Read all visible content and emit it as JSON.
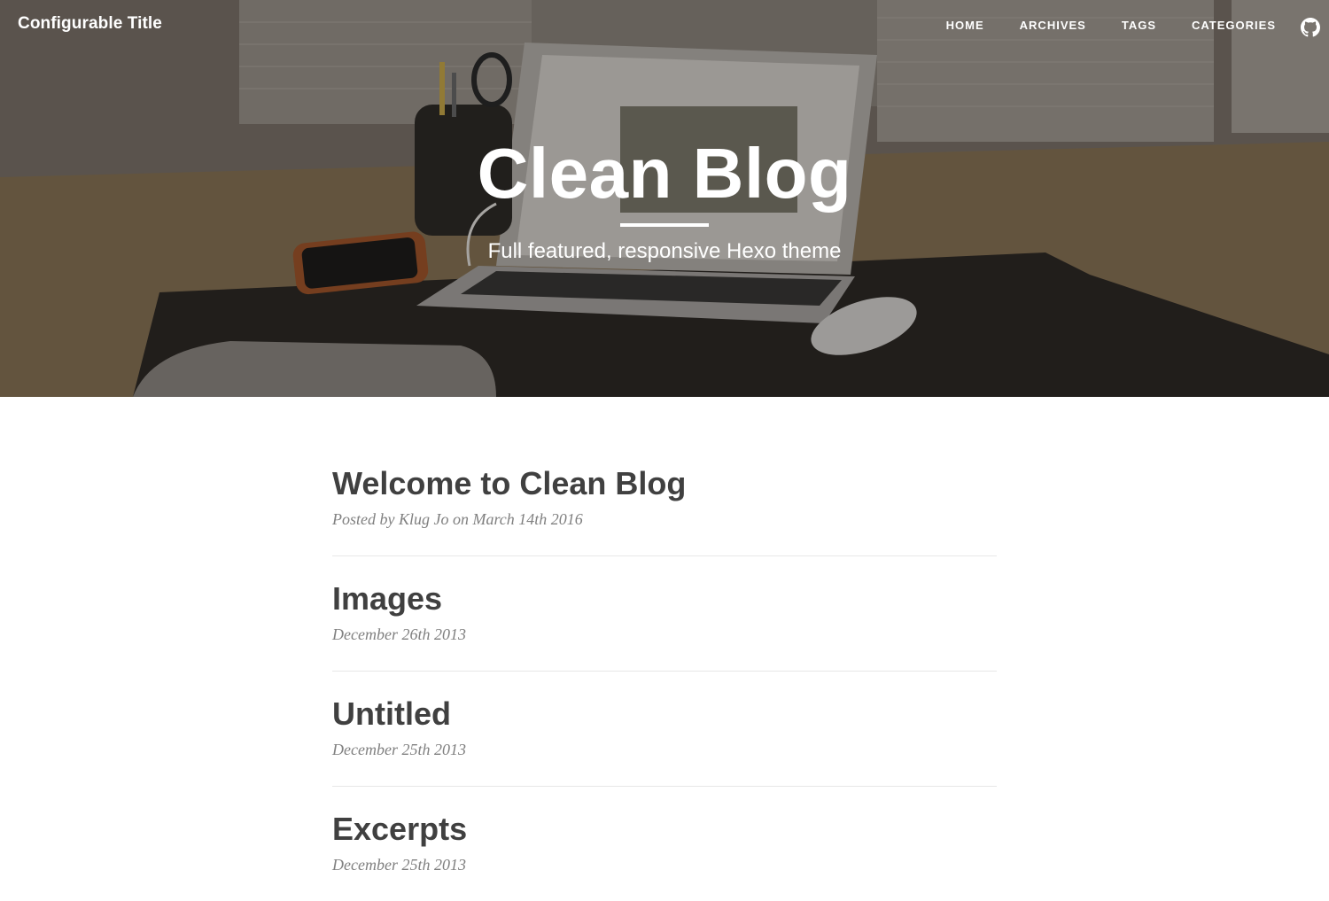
{
  "navbar": {
    "brand": "Configurable Title",
    "links": [
      "HOME",
      "ARCHIVES",
      "TAGS",
      "CATEGORIES"
    ],
    "github_icon": "github-icon"
  },
  "hero": {
    "title": "Clean Blog",
    "subtitle": "Full featured, responsive Hexo theme",
    "background": "desk-with-laptop-photo"
  },
  "posts": [
    {
      "title": "Welcome to Clean Blog",
      "meta": "Posted by Klug Jo on March 14th 2016"
    },
    {
      "title": "Images",
      "meta": "December 26th 2013"
    },
    {
      "title": "Untitled",
      "meta": "December 25th 2013"
    },
    {
      "title": "Excerpts",
      "meta": "December 25th 2013"
    }
  ],
  "colors": {
    "text": "#404040",
    "meta": "#808080",
    "divider": "#e7e7e7",
    "nav_text": "#ffffff"
  }
}
